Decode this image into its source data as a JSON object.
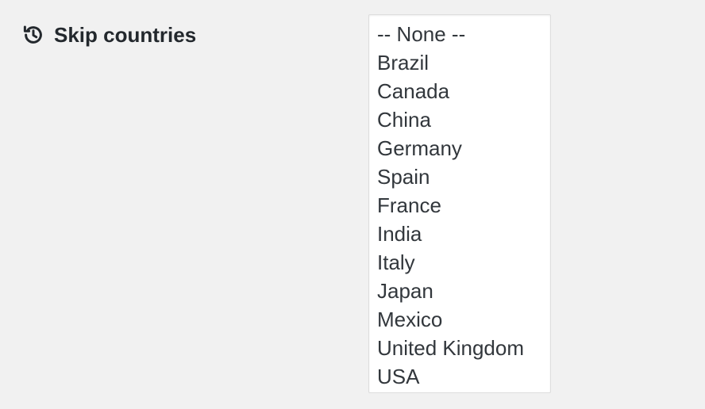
{
  "field": {
    "icon": "history-icon",
    "label": "Skip countries"
  },
  "select": {
    "options": [
      "-- None --",
      "Brazil",
      "Canada",
      "China",
      "Germany",
      "Spain",
      "France",
      "India",
      "Italy",
      "Japan",
      "Mexico",
      "United Kingdom",
      "USA"
    ]
  }
}
